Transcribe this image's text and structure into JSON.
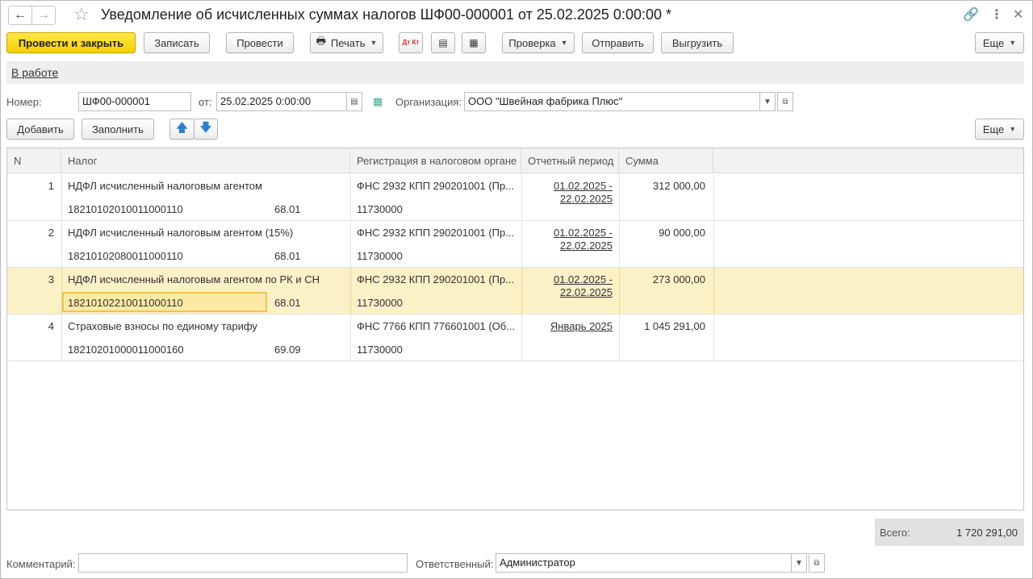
{
  "window": {
    "title": "Уведомление об исчисленных суммах налогов ШФ00-000001 от 25.02.2025 0:00:00 *"
  },
  "toolbar": {
    "post_close": "Провести и закрыть",
    "save": "Записать",
    "post": "Провести",
    "print": "Печать",
    "dtkt_icon": "Дт Кт",
    "check": "Проверка",
    "send": "Отправить",
    "upload": "Выгрузить",
    "more": "Еще"
  },
  "status": {
    "link": "В работе"
  },
  "form": {
    "number_label": "Номер:",
    "number_value": "ШФ00-000001",
    "date_label": "от:",
    "date_value": "25.02.2025  0:00:00",
    "org_label": "Организация:",
    "org_value": "ООО \"Швейная фабрика Плюс\""
  },
  "table_toolbar": {
    "add": "Добавить",
    "fill": "Заполнить",
    "more": "Еще"
  },
  "table": {
    "columns": [
      "N",
      "Налог",
      "Регистрация в налоговом органе",
      "Отчетный период",
      "Сумма"
    ],
    "rows": [
      {
        "n": "1",
        "tax": "НДФЛ исчисленный налоговым агентом",
        "kbk": "18210102010011000110",
        "account": "68.01",
        "reg": "ФНС 2932 КПП 290201001 (Пр...",
        "oktmo": "11730000",
        "period1": "01.02.2025 -",
        "period2": "22.02.2025",
        "sum": "312 000,00"
      },
      {
        "n": "2",
        "tax": "НДФЛ исчисленный налоговым агентом (15%)",
        "kbk": "18210102080011000110",
        "account": "68.01",
        "reg": "ФНС 2932 КПП 290201001 (Пр...",
        "oktmo": "11730000",
        "period1": "01.02.2025 -",
        "period2": "22.02.2025",
        "sum": "90 000,00"
      },
      {
        "n": "3",
        "tax": "НДФЛ исчисленный налоговым агентом по РК и СН",
        "kbk": "18210102210011000110",
        "account": "68.01",
        "reg": "ФНС 2932 КПП 290201001 (Пр...",
        "oktmo": "11730000",
        "period1": "01.02.2025 -",
        "period2": "22.02.2025",
        "sum": "273 000,00"
      },
      {
        "n": "4",
        "tax": "Страховые взносы по единому тарифу",
        "kbk": "18210201000011000160",
        "account": "69.09",
        "reg": "ФНС 7766 КПП 776601001 (Об...",
        "oktmo": "11730000",
        "period1": "Январь 2025",
        "period2": "",
        "sum": "1 045 291,00"
      }
    ]
  },
  "totals": {
    "label": "Всего:",
    "value": "1 720 291,00"
  },
  "footer": {
    "comment_label": "Комментарий:",
    "comment_value": "",
    "responsible_label": "Ответственный:",
    "responsible_value": "Администратор"
  }
}
